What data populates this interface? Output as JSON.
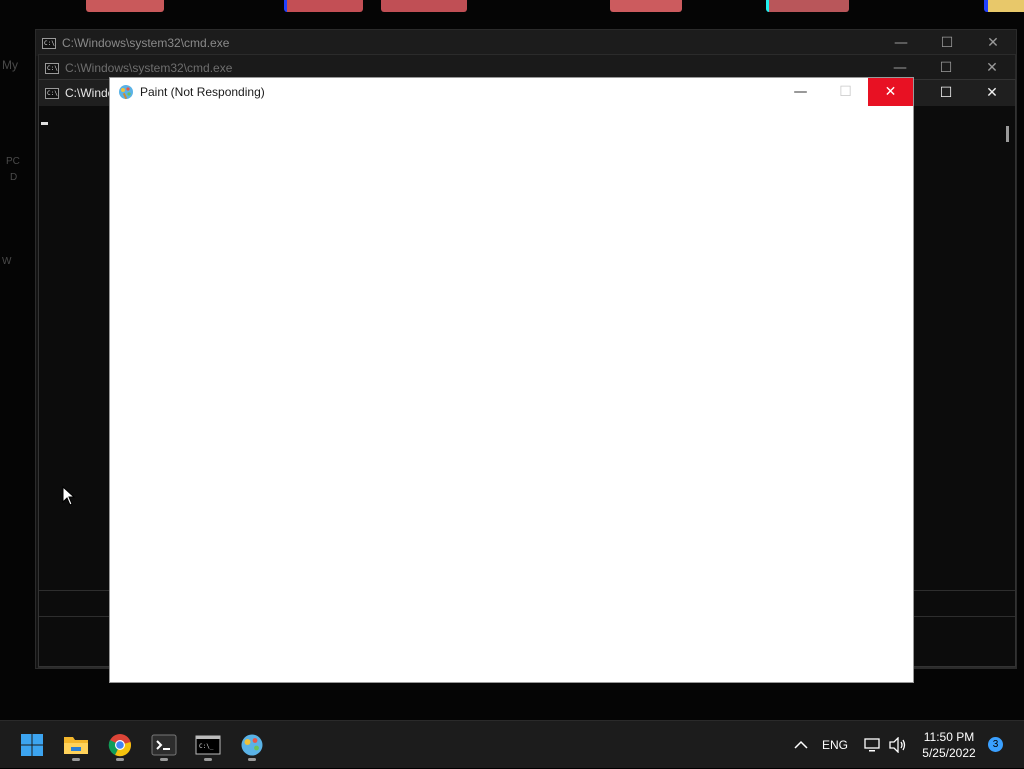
{
  "desktop": {
    "fragments": [
      "My",
      "PC",
      "D",
      "W"
    ],
    "icon_colors": [
      "#c9595b",
      "#c34f55",
      "#c04f55",
      "#cc5b5e",
      "#b9565a",
      "#e8c86a"
    ]
  },
  "windows": {
    "cmd_back": {
      "title": "C:\\Windows\\system32\\cmd.exe",
      "icon": "cmd-icon"
    },
    "cmd_mid": {
      "title": "C:\\Windows\\system32\\cmd.exe",
      "icon": "cmd-icon"
    },
    "cmd_front": {
      "title": "C:\\Windo",
      "icon": "cmd-icon"
    },
    "paint": {
      "title": "Paint (Not Responding)",
      "icon": "paint-icon",
      "close_color": "#e81123"
    }
  },
  "window_controls": {
    "minimize": "—",
    "maximize": "☐",
    "close": "✕"
  },
  "taskbar": {
    "apps": [
      {
        "name": "start",
        "icon": "windows-logo-icon"
      },
      {
        "name": "file-explorer",
        "icon": "folder-icon",
        "running": true
      },
      {
        "name": "chrome",
        "icon": "chrome-icon",
        "running": true
      },
      {
        "name": "terminal",
        "icon": "terminal-icon",
        "running": true
      },
      {
        "name": "cmd",
        "icon": "cmd-icon",
        "running": true
      },
      {
        "name": "paint",
        "icon": "paint-icon",
        "running": true
      }
    ],
    "tray": {
      "chevron": "^",
      "language": "ENG",
      "time": "11:50 PM",
      "date": "5/25/2022",
      "notifications": "3"
    }
  }
}
